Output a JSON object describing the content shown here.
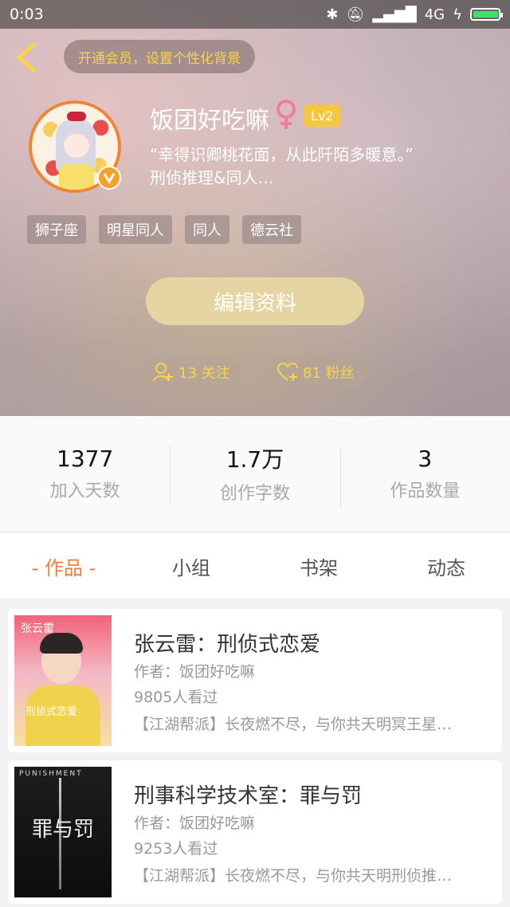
{
  "status_bar": {
    "time": "0:03",
    "network": "4G"
  },
  "header": {
    "vip_banner": "开通会员，设置个性化背景",
    "nickname": "饭团好吃嘛",
    "level": "Lv2",
    "bio_line1": "“幸得识卿桃花面，从此阡陌多暖意。”",
    "bio_line2": "刑侦推理&同人…",
    "tags": [
      "狮子座",
      "明星同人",
      "同人",
      "德云社"
    ],
    "edit_button": "编辑资料",
    "following": "13 关注",
    "followers": "81 粉丝"
  },
  "stats": [
    {
      "value": "1377",
      "label": "加入天数"
    },
    {
      "value": "1.7万",
      "label": "创作字数"
    },
    {
      "value": "3",
      "label": "作品数量"
    }
  ],
  "tabs": [
    "- 作品 -",
    "小组",
    "书架",
    "动态"
  ],
  "works": [
    {
      "title": "张云雷：刑侦式恋爱",
      "author": "作者：饭团好吃嘛",
      "views": "9805人看过",
      "desc": "【江湖帮派】长夜燃不尽，与你共天明冥王星…",
      "cover_text": "张云雷",
      "cover_text2": "刑侦式恋爱"
    },
    {
      "title": "刑事科学技术室：罪与罚",
      "author": "作者：饭团好吃嘛",
      "views": "9253人看过",
      "desc": "【江湖帮派】长夜燃不尽，与你共天明刑侦推…",
      "cover_text": "PUNISHMENT",
      "cover_text2": "罪与罚"
    }
  ],
  "colors": {
    "accent": "#f07b3f",
    "gold": "#f7d44a",
    "level_badge": "#f7c640"
  }
}
